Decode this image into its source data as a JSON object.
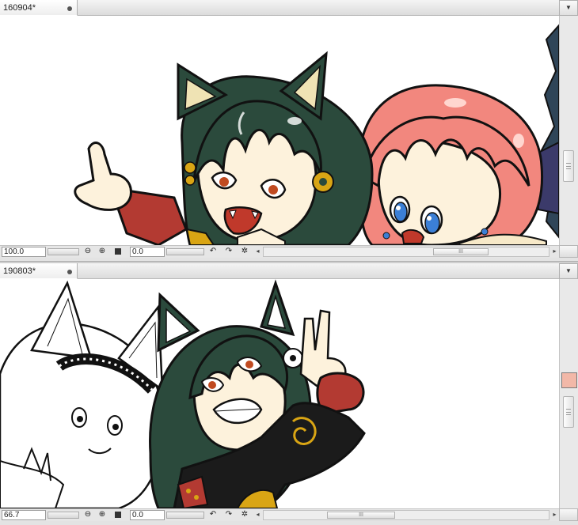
{
  "top_document": {
    "tab_title": "160904*",
    "zoom": "100.0",
    "rotation": "0.0",
    "hscroll_grip": "III",
    "illustration": "Chibi cat-eared dark-green-haired girl pointing, beside a pink-haired girl with blue eyes"
  },
  "bottom_document": {
    "tab_title": "190803*",
    "zoom": "66.7",
    "rotation": "0.0",
    "hscroll_grip": "III",
    "illustration": "Line-art fox-eared character with goggles beside a grinning cat-eared dark-green-haired girl making a peace sign"
  },
  "icons": {
    "zoom_out": "zoom-out-icon",
    "zoom_in": "zoom-in-icon",
    "fit": "fit-screen-icon",
    "rotate_left": "rotate-left-icon",
    "rotate_right": "rotate-right-icon",
    "reset_rotation": "reset-rotation-icon",
    "close_dot": "tab-modified-dot-icon",
    "menu": "tab-menu-icon"
  },
  "colors": {
    "green_hair": "#2b4a3c",
    "pink_hair": "#f2877e",
    "skin": "#fdf2dc",
    "sleeve_red": "#b33a32",
    "ear_inner": "#efe3b4",
    "ui_bg": "#e3e3e3"
  }
}
